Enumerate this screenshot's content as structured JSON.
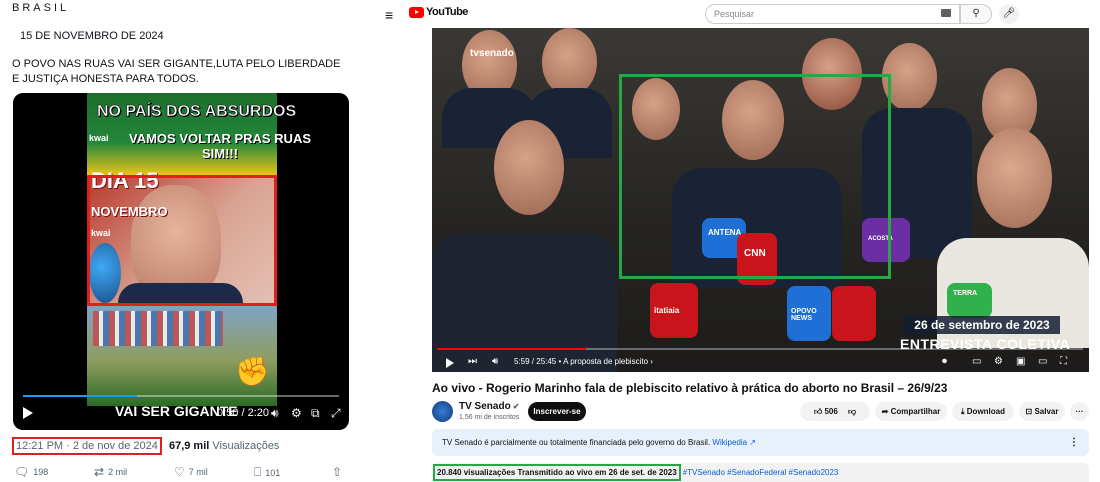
{
  "tweet": {
    "brand": "BRASIL",
    "date_line": "15 DE NOVEMBRO DE 2024",
    "text": "O POVO NAS RUAS VAI SER GIGANTE,LUTA PELO LIBERDADE E JUSTIÇA HONESTA PARA TODOS.",
    "video": {
      "overlay_top": "NO PAÍS DOS ABSURDOS",
      "overlay_call_1": "VAMOS VOLTAR PRAS RUAS",
      "overlay_call_2": "SIM!!!",
      "overlay_dia": "DIA 15",
      "overlay_novembro": "NOVEMBRO",
      "kwai_1": "kwai",
      "kwai_2": "kwai",
      "overlay_bottom": "VAI SER GIGANTE",
      "time": "0:50 / 2:20",
      "progress": 0.36
    },
    "timestamp": "12:21 PM · 2 de nov de 2024",
    "views_count": "67,9 mil",
    "views_label": "Visualizações",
    "actions": {
      "replies": "198",
      "reposts": "2 mil",
      "likes": "7 mil",
      "bookmarks": "101"
    },
    "highlight_color": "#e0201c"
  },
  "youtube": {
    "search_placeholder": "Pesquisar",
    "video": {
      "watermark": "tvsenado",
      "date_overlay": "26 de setembro de 2023",
      "lower_third": "ENTREVISTA COLETIVA",
      "time": "5:59 / 25:45",
      "chapter": "• A proposta de plebiscito ›",
      "progress": 0.23,
      "mic_labels": [
        "ANTENA",
        "CNN",
        "ACOSTA",
        "itatiaia",
        "OPOVO NEWS",
        "TERRA"
      ]
    },
    "title": "Ao vivo - Rogerio Marinho fala de plebiscito relativo à prática do aborto no Brasil – 26/9/23",
    "channel": {
      "name": "TV Senado",
      "subscribers": "1,56 mi de inscritos",
      "subscribe_label": "Inscrever-se"
    },
    "buttons": {
      "likes": "506",
      "share": "Compartilhar",
      "download": "Download",
      "save": "Salvar",
      "more": "···"
    },
    "banner_text": "TV Senado é parcialmente ou totalmente financiada pelo governo do Brasil.",
    "banner_link": "Wikipedia ↗",
    "description_stats": "20.840 visualizações  Transmitido ao vivo em 26 de set. de 2023",
    "description_tags": "#TVSenado #SenadoFederal #Senado2023",
    "highlight_color": "#27a844"
  }
}
